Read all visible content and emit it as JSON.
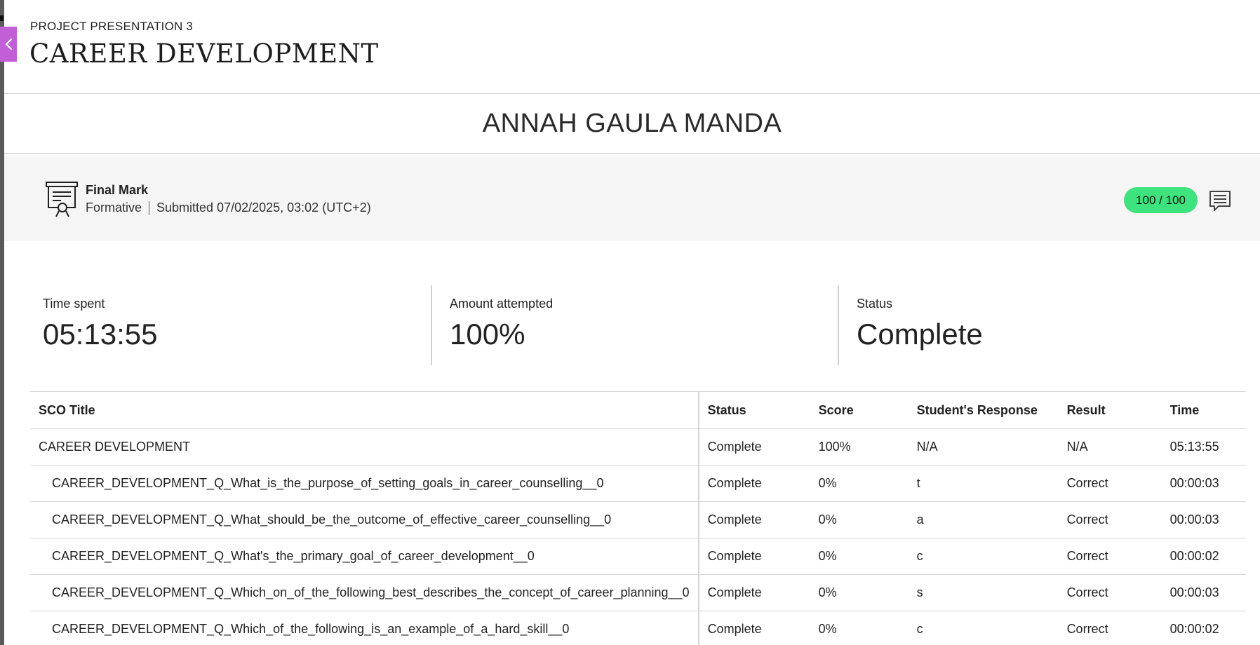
{
  "header": {
    "eyebrow": "PROJECT PRESENTATION 3",
    "title": "CAREER DEVELOPMENT"
  },
  "student": {
    "name": "ANNAH GAULA MANDA"
  },
  "final_mark": {
    "title": "Final Mark",
    "type": "Formative",
    "submitted": "Submitted 07/02/2025, 03:02 (UTC+2)",
    "grade": "100 / 100",
    "grade_color": "#3ee37e"
  },
  "stats": {
    "time_spent": {
      "label": "Time spent",
      "value": "05:13:55"
    },
    "amount_attempted": {
      "label": "Amount attempted",
      "value": "100%"
    },
    "status": {
      "label": "Status",
      "value": "Complete"
    }
  },
  "table": {
    "headers": [
      "SCO Title",
      "Status",
      "Score",
      "Student's Response",
      "Result",
      "Time"
    ],
    "rows": [
      {
        "title": "CAREER DEVELOPMENT",
        "status": "Complete",
        "score": "100%",
        "response": "N/A",
        "result": "N/A",
        "time": "05:13:55"
      },
      {
        "title": "CAREER_DEVELOPMENT_Q_What_is_the_purpose_of_setting_goals_in_career_counselling__0",
        "status": "Complete",
        "score": "0%",
        "response": "t",
        "result": "Correct",
        "time": "00:00:03"
      },
      {
        "title": "CAREER_DEVELOPMENT_Q_What_should_be_the_outcome_of_effective_career_counselling__0",
        "status": "Complete",
        "score": "0%",
        "response": "a",
        "result": "Correct",
        "time": "00:00:03"
      },
      {
        "title": "CAREER_DEVELOPMENT_Q_What's_the_primary_goal_of_career_development__0",
        "status": "Complete",
        "score": "0%",
        "response": "c",
        "result": "Correct",
        "time": "00:00:02"
      },
      {
        "title": "CAREER_DEVELOPMENT_Q_Which_on_of_the_following_best_describes_the_concept_of_career_planning__0",
        "status": "Complete",
        "score": "0%",
        "response": "s",
        "result": "Correct",
        "time": "00:00:03"
      },
      {
        "title": "CAREER_DEVELOPMENT_Q_Which_of_the_following_is_an_example_of_a_hard_skill__0",
        "status": "Complete",
        "score": "0%",
        "response": "c",
        "result": "Correct",
        "time": "00:00:02"
      }
    ]
  },
  "icons": {
    "back": "chevron-left-icon",
    "final_mark": "certificate-icon",
    "feedback": "comment-icon"
  },
  "colors": {
    "accent": "#c35fd6",
    "grade_pill": "#3ee37e"
  }
}
